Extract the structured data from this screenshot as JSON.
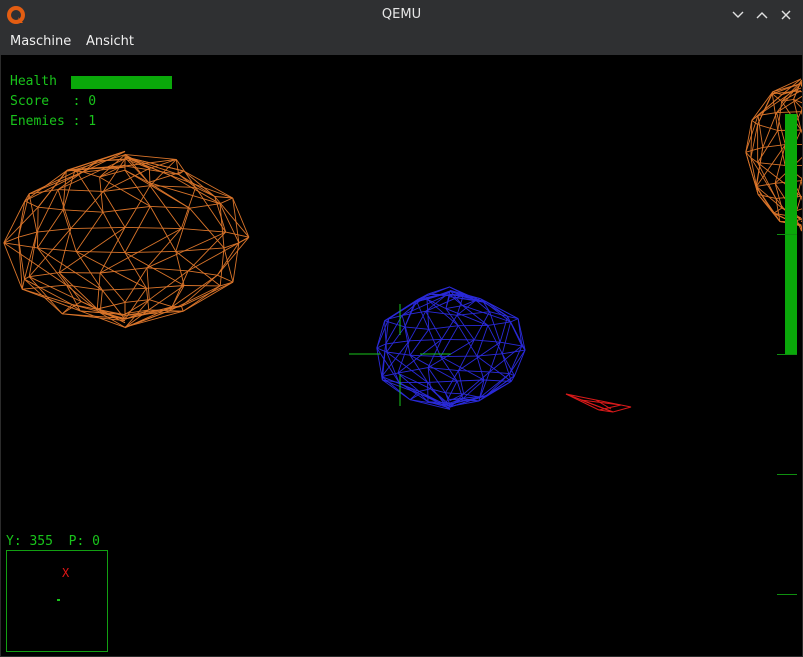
{
  "window": {
    "title": "QEMU"
  },
  "menubar": {
    "items": [
      "Maschine",
      "Ansicht"
    ]
  },
  "hud": {
    "health_label": "Health",
    "health_fraction": 1.0,
    "score_line": "Score   : 0",
    "enemies_line": "Enemies : 1",
    "radar_readout": "Y: 355  P: 0",
    "radar_target": "X",
    "throttle_fraction": 1.0
  },
  "colors": {
    "hud_green": "#19c41b",
    "asteroid_orange": "#d9742a",
    "enemy_blue": "#2a2ad9",
    "ship_red": "#d91a1a"
  },
  "icons": {
    "app": "qemu-logo-icon",
    "minimize": "chevron-down-icon",
    "maximize": "chevron-up-icon",
    "close": "close-icon"
  }
}
